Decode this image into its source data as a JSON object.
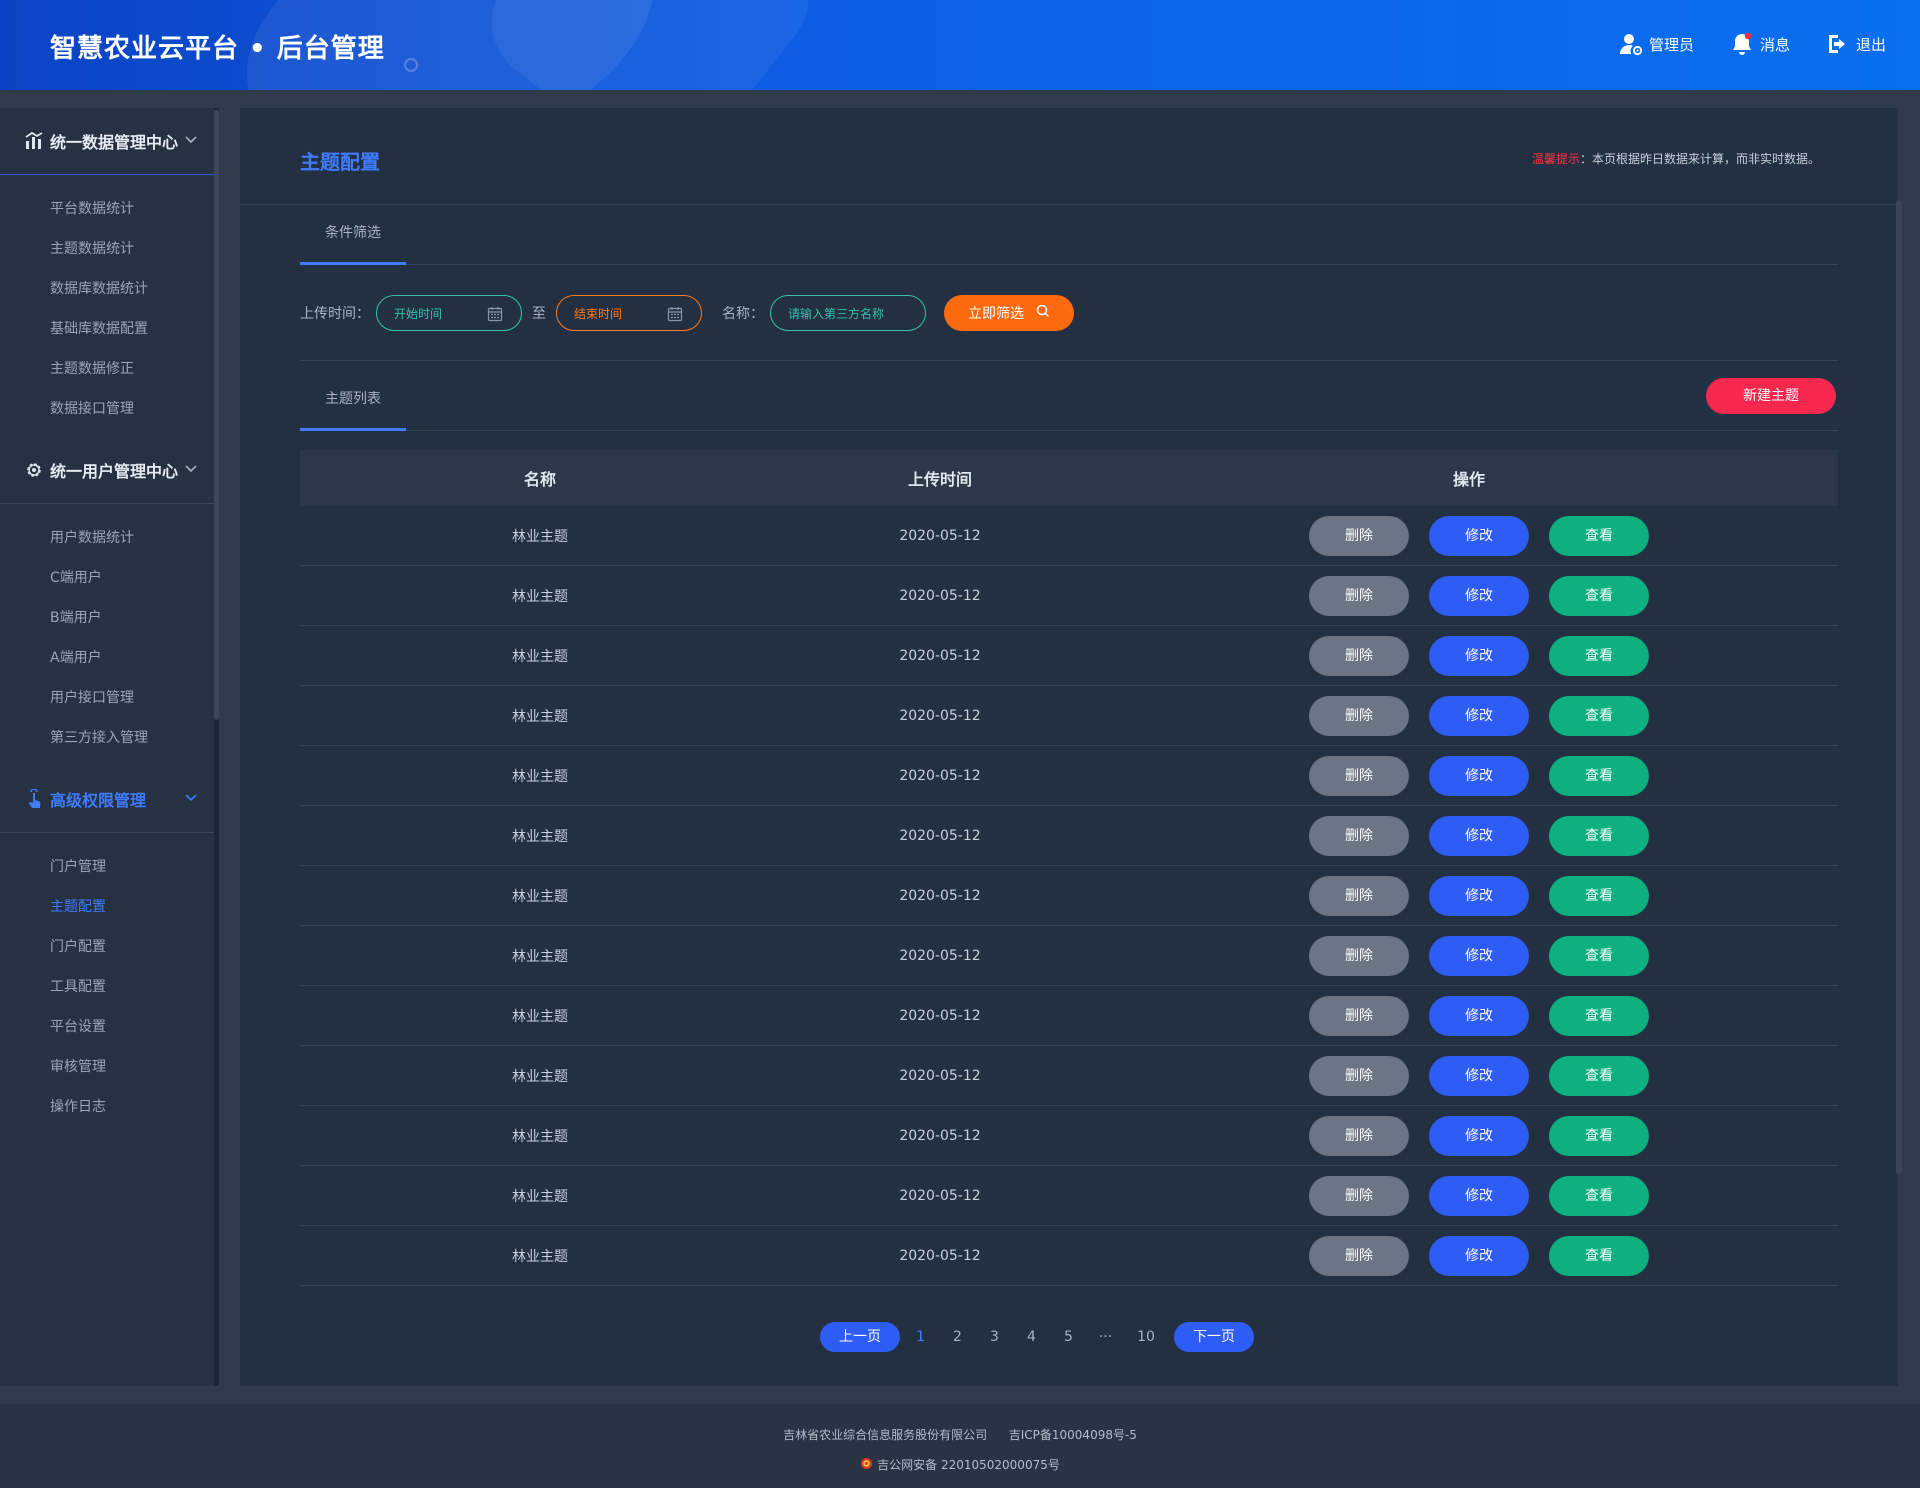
{
  "header": {
    "title": "智慧农业云平台 • 后台管理",
    "actions": [
      {
        "label": "管理员",
        "icon": "user-settings-icon"
      },
      {
        "label": "消息",
        "icon": "bell-icon"
      },
      {
        "label": "退出",
        "icon": "logout-icon"
      }
    ]
  },
  "sidebar": {
    "groups": [
      {
        "title": "统一数据管理中心",
        "icon": "chart-icon",
        "items": [
          "平台数据统计",
          "主题数据统计",
          "数据库数据统计",
          "基础库数据配置",
          "主题数据修正",
          "数据接口管理"
        ]
      },
      {
        "title": "统一用户管理中心",
        "icon": "gear-icon",
        "items": [
          "用户数据统计",
          "C端用户",
          "B端用户",
          "A端用户",
          "用户接口管理",
          "第三方接入管理"
        ]
      },
      {
        "title": "高级权限管理",
        "icon": "touch-icon",
        "items": [
          "门户管理",
          "主题配置",
          "门户配置",
          "工具配置",
          "平台设置",
          "审核管理",
          "操作日志"
        ]
      }
    ],
    "active_item": "主题配置"
  },
  "page": {
    "title": "主题配置",
    "notice_label": "温馨提示",
    "notice_text": "：本页根据昨日数据来计算，而非实时数据。"
  },
  "filter": {
    "tab": "条件筛选",
    "time_label": "上传时间：",
    "start_placeholder": "开始时间",
    "to": "至",
    "end_placeholder": "结束时间",
    "name_label": "名称：",
    "name_placeholder": "请输入第三方名称",
    "search_button": "立即筛选"
  },
  "list": {
    "tab": "主题列表",
    "new_button": "新建主题",
    "columns": [
      "名称",
      "上传时间",
      "操作"
    ],
    "actions": {
      "delete": "删除",
      "edit": "修改",
      "view": "查看"
    },
    "rows": [
      {
        "name": "林业主题",
        "time": "2020-05-12"
      },
      {
        "name": "林业主题",
        "time": "2020-05-12"
      },
      {
        "name": "林业主题",
        "time": "2020-05-12"
      },
      {
        "name": "林业主题",
        "time": "2020-05-12"
      },
      {
        "name": "林业主题",
        "time": "2020-05-12"
      },
      {
        "name": "林业主题",
        "time": "2020-05-12"
      },
      {
        "name": "林业主题",
        "time": "2020-05-12"
      },
      {
        "name": "林业主题",
        "time": "2020-05-12"
      },
      {
        "name": "林业主题",
        "time": "2020-05-12"
      },
      {
        "name": "林业主题",
        "time": "2020-05-12"
      },
      {
        "name": "林业主题",
        "time": "2020-05-12"
      },
      {
        "name": "林业主题",
        "time": "2020-05-12"
      },
      {
        "name": "林业主题",
        "time": "2020-05-12"
      }
    ]
  },
  "pagination": {
    "prev": "上一页",
    "next": "下一页",
    "pages": [
      "1",
      "2",
      "3",
      "4",
      "5",
      "···",
      "10"
    ],
    "current": "1"
  },
  "footer": {
    "company": "吉林省农业综合信息服务股份有限公司",
    "icp": "吉ICP备10004098号-5",
    "police": "吉公网安备 22010502000075号"
  },
  "colors": {
    "accent": "#3f7bff",
    "search": "#ff6a0f",
    "new": "#f8274d",
    "delete": "#6b7584",
    "edit": "#2e5df5",
    "view": "#0db07e"
  }
}
